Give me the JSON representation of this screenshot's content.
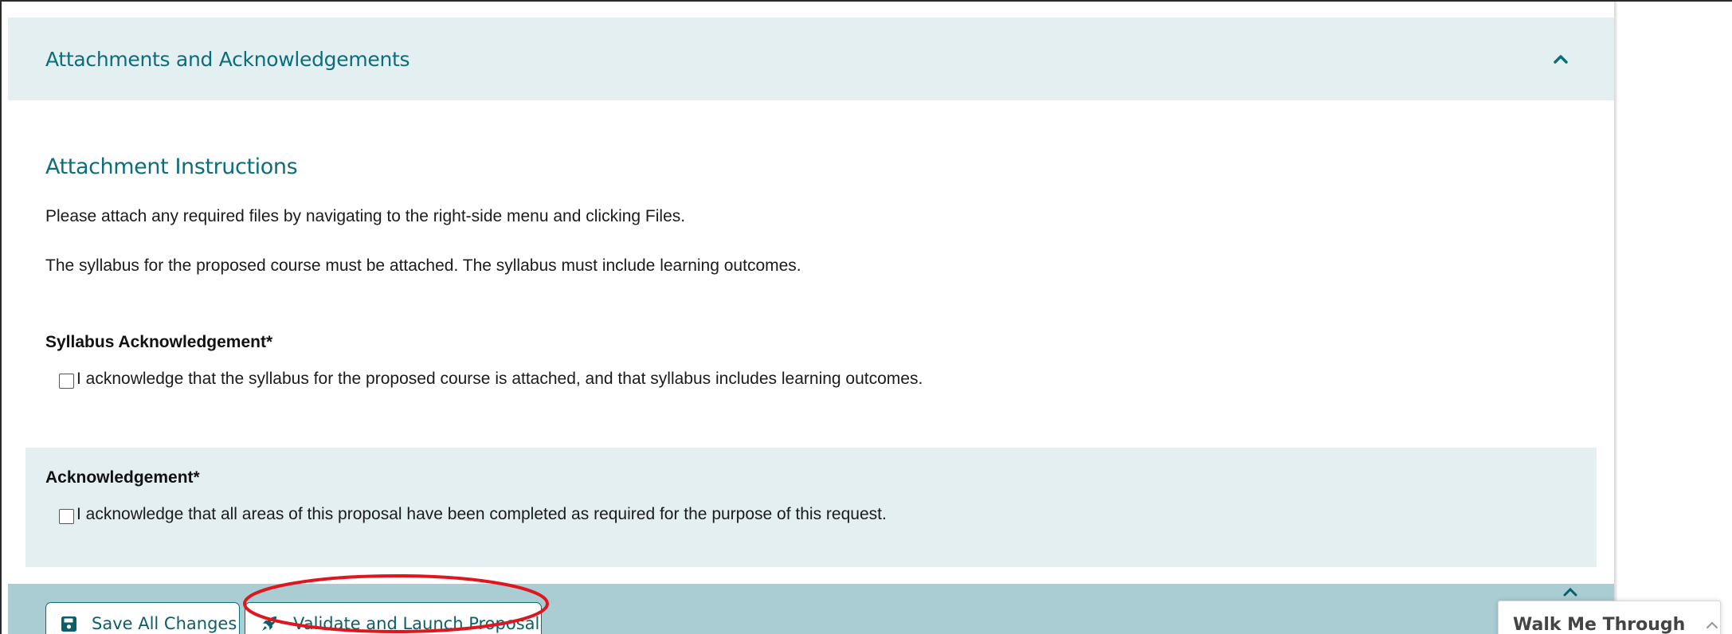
{
  "section": {
    "title": "Attachments and Acknowledgements",
    "collapse_icon": "chevron-up-icon"
  },
  "instructions": {
    "title": "Attachment Instructions",
    "line1": "Please attach any required files by navigating to the right-side menu and clicking Files.",
    "line2": "The syllabus for the proposed course must be attached. The syllabus must include learning outcomes."
  },
  "syllabus_ack": {
    "label": "Syllabus Acknowledgement*",
    "checkbox_text": "I acknowledge that the syllabus for the proposed course is attached, and that syllabus includes learning outcomes.",
    "checked": false
  },
  "general_ack": {
    "label": "Acknowledgement*",
    "checkbox_text": "I acknowledge that all areas of this proposal have been completed as required for the purpose of this request.",
    "checked": false
  },
  "footer": {
    "save_label": "Save All Changes",
    "save_icon": "floppy-disk-icon",
    "launch_label": "Validate and Launch Proposal",
    "launch_icon": "rocket-icon"
  },
  "walkme": {
    "label": "Walk Me Through",
    "icon": "chevron-up-icon"
  },
  "colors": {
    "accent": "#0b6e7a",
    "header_bg": "#e3eff1",
    "footer_bg": "#a9cdd3",
    "highlight": "#e0161e"
  }
}
